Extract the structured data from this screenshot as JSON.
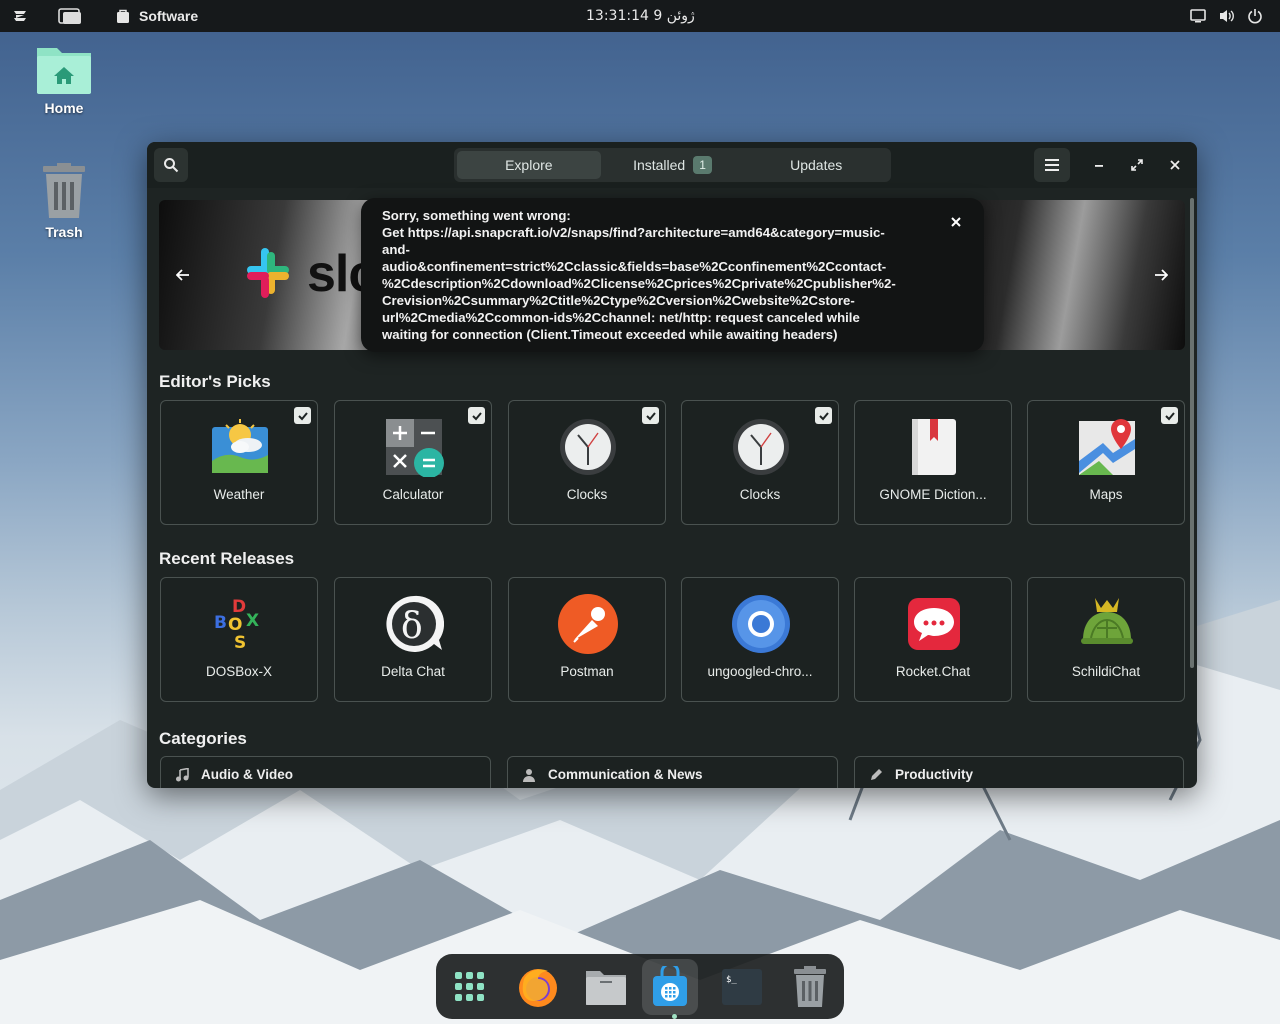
{
  "topbar": {
    "app_name": "Software",
    "clock": "13:31:14  ژوئن 9"
  },
  "desktop": {
    "home_label": "Home",
    "trash_label": "Trash"
  },
  "window": {
    "tabs": [
      {
        "label": "Explore",
        "active": true
      },
      {
        "label": "Installed",
        "badge": "1"
      },
      {
        "label": "Updates"
      }
    ],
    "banner": {
      "logo_text": "slc"
    },
    "error": {
      "message": "Sorry, something went wrong:\nGet https://api.snapcraft.io/v2/snaps/find?architecture=amd64&category=music-\nand-\naudio&confinement=strict%2Cclassic&fields=base%2Cconfinement%2Ccontact-\n%2Cdescription%2Cdownload%2Clicense%2Cprices%2Cprivate%2Cpublisher%2-\nCrevision%2Csummary%2Ctitle%2Ctype%2Cversion%2Cwebsite%2Cstore-\nurl%2Cmedia%2Ccommon-ids%2Cchannel: net/http: request canceled while\nwaiting for connection (Client.Timeout exceeded while awaiting headers)"
    },
    "editors_picks": {
      "title": "Editor's Picks",
      "items": [
        {
          "label": "Weather",
          "icon": "weather-icon",
          "installed": true
        },
        {
          "label": "Calculator",
          "icon": "calculator-icon",
          "installed": true
        },
        {
          "label": "Clocks",
          "icon": "clock-icon",
          "installed": true
        },
        {
          "label": "Clocks",
          "icon": "clock-icon",
          "installed": true
        },
        {
          "label": "GNOME Diction...",
          "icon": "dictionary-icon",
          "installed": false
        },
        {
          "label": "Maps",
          "icon": "maps-icon",
          "installed": true
        }
      ]
    },
    "recent_releases": {
      "title": "Recent Releases",
      "items": [
        {
          "label": "DOSBox-X",
          "icon": "dosbox-icon"
        },
        {
          "label": "Delta Chat",
          "icon": "delta-chat-icon"
        },
        {
          "label": "Postman",
          "icon": "postman-icon"
        },
        {
          "label": "ungoogled-chro...",
          "icon": "chromium-icon"
        },
        {
          "label": "Rocket.Chat",
          "icon": "rocket-chat-icon"
        },
        {
          "label": "SchildiChat",
          "icon": "schildichat-icon"
        }
      ]
    },
    "categories": {
      "title": "Categories",
      "items": [
        {
          "label": "Audio & Video",
          "icon": "music-note-icon"
        },
        {
          "label": "Communication & News",
          "icon": "person-icon"
        },
        {
          "label": "Productivity",
          "icon": "pencil-icon"
        }
      ]
    }
  },
  "colors": {
    "accent": "#2bb5a3",
    "window_bg": "#1e2423",
    "topbar_bg": "#16191b"
  }
}
